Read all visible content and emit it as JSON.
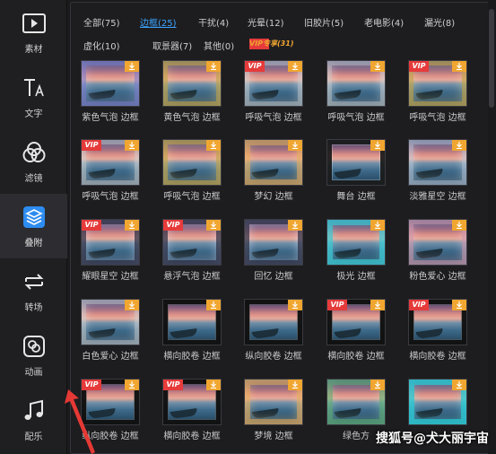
{
  "sidebar": {
    "items": [
      {
        "label": "素材",
        "icon": "media-folder-icon",
        "active": false
      },
      {
        "label": "文字",
        "icon": "text-icon",
        "active": false
      },
      {
        "label": "滤镜",
        "icon": "filter-icon",
        "active": false
      },
      {
        "label": "叠附",
        "icon": "layers-icon",
        "active": true
      },
      {
        "label": "转场",
        "icon": "transition-icon",
        "active": false
      },
      {
        "label": "动画",
        "icon": "animation-icon",
        "active": false
      },
      {
        "label": "配乐",
        "icon": "music-note-icon",
        "active": false
      }
    ]
  },
  "filters": [
    {
      "label": "全部(75)",
      "active": false
    },
    {
      "label": "边框(25)",
      "active": true
    },
    {
      "label": "干扰(4)",
      "active": false
    },
    {
      "label": "光晕(12)",
      "active": false
    },
    {
      "label": "旧胶片(5)",
      "active": false
    },
    {
      "label": "老电影(4)",
      "active": false
    },
    {
      "label": "漏光(8)",
      "active": false
    },
    {
      "label": "虚化(10)",
      "active": false
    },
    {
      "label": "取景器(7)",
      "active": false
    },
    {
      "label": "其他(0)",
      "active": false
    },
    {
      "label": "VIP专享(31)",
      "active": false
    }
  ],
  "grid": [
    {
      "label": "紫色气泡 边框",
      "vip": false,
      "frame": "purple"
    },
    {
      "label": "黄色气泡 边框",
      "vip": false,
      "frame": "gold"
    },
    {
      "label": "呼吸气泡 边框",
      "vip": true,
      "frame": "bubble"
    },
    {
      "label": "呼吸气泡 边框",
      "vip": false,
      "frame": "bubble"
    },
    {
      "label": "呼吸气泡 边框",
      "vip": true,
      "frame": "gold"
    },
    {
      "label": "呼吸气泡 边框",
      "vip": true,
      "frame": "bubble"
    },
    {
      "label": "呼吸气泡 边框",
      "vip": false,
      "frame": "gold"
    },
    {
      "label": "梦幻 边框",
      "vip": false,
      "frame": "dream"
    },
    {
      "label": "舞台 边框",
      "vip": false,
      "frame": "stage"
    },
    {
      "label": "淡雅星空 边框",
      "vip": false,
      "frame": "star"
    },
    {
      "label": "耀眼星空 边框",
      "vip": true,
      "frame": "glow"
    },
    {
      "label": "悬浮气泡 边框",
      "vip": true,
      "frame": "glow"
    },
    {
      "label": "回忆 边框",
      "vip": false,
      "frame": "glow"
    },
    {
      "label": "极光 边框",
      "vip": false,
      "frame": "aurora"
    },
    {
      "label": "粉色爱心 边框",
      "vip": false,
      "frame": "pink"
    },
    {
      "label": "白色爱心 边框",
      "vip": false,
      "frame": "bubble"
    },
    {
      "label": "横向胶卷 边框",
      "vip": false,
      "frame": "film"
    },
    {
      "label": "纵向胶卷 边框",
      "vip": false,
      "frame": "film"
    },
    {
      "label": "横向胶卷 边框",
      "vip": true,
      "frame": "film"
    },
    {
      "label": "横向胶卷 边框",
      "vip": true,
      "frame": "film"
    },
    {
      "label": "纵向胶卷 边框",
      "vip": true,
      "frame": "film"
    },
    {
      "label": "横向胶卷 边框",
      "vip": true,
      "frame": "film"
    },
    {
      "label": "梦境 边框",
      "vip": false,
      "frame": "dream"
    },
    {
      "label": "绿色方",
      "vip": false,
      "frame": "green"
    },
    {
      "label": "",
      "vip": false,
      "frame": "teal"
    }
  ],
  "badges": {
    "vip_text": "VIP"
  },
  "watermark": "搜狐号@犬大丽宇宙",
  "colors": {
    "accent": "#3ba4ff",
    "vip": "#f0a630",
    "active_icon": "#2d8cf0",
    "arrow": "#e53935"
  }
}
